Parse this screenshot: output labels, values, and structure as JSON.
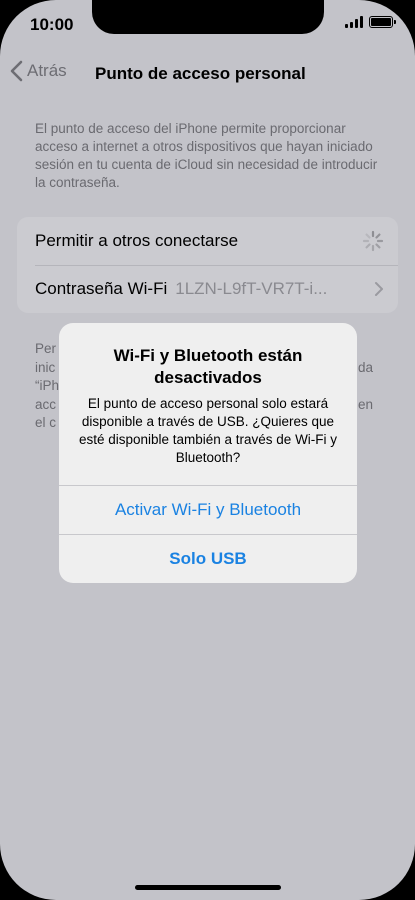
{
  "status_bar": {
    "time": "10:00"
  },
  "nav": {
    "back_label": "Atrás",
    "title": "Punto de acceso personal"
  },
  "description": "El punto de acceso del iPhone permite proporcionar acceso a internet a otros dispositivos que hayan iniciado sesión en tu cuenta de iCloud sin necesidad de introducir la contraseña.",
  "settings": {
    "allow_others_label": "Permitir a otros conectarse",
    "wifi_password_label": "Contraseña Wi-Fi",
    "wifi_password_value": "1LZN-L9fT-VR7T-i..."
  },
  "footer_fragments": {
    "line1_left": "Per",
    "line2_left": "inic",
    "line2_right": "da",
    "line3_left": "“iPh",
    "line4_left": "acc",
    "line4_right": "en",
    "line5_left": "el c"
  },
  "alert": {
    "title": "Wi-Fi y Bluetooth están desactivados",
    "message": "El punto de acceso personal solo estará disponible a través de USB. ¿Quieres que esté disponible también a través de Wi-Fi y Bluetooth?",
    "primary_button": "Activar Wi-Fi y Bluetooth",
    "secondary_button": "Solo USB"
  },
  "colors": {
    "accent": "#1a82e2",
    "dimmed_background": "#c3c3c9"
  },
  "icons": [
    "chevron-left-icon",
    "signal-icon",
    "battery-icon",
    "spinner-icon",
    "chevron-right-icon"
  ]
}
